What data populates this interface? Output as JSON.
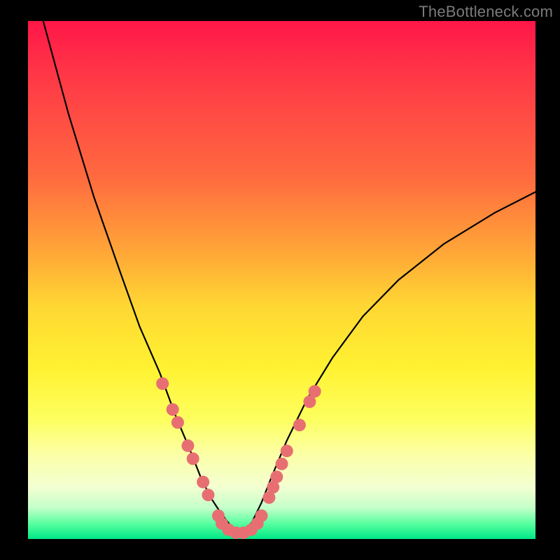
{
  "watermark": "TheBottleneck.com",
  "chart_data": {
    "type": "line",
    "title": "",
    "xlabel": "",
    "ylabel": "",
    "xlim": [
      0,
      100
    ],
    "ylim": [
      0,
      100
    ],
    "gradient_stops": [
      {
        "pct": 0,
        "color": "#ff1648"
      },
      {
        "pct": 10,
        "color": "#ff3647"
      },
      {
        "pct": 30,
        "color": "#ff6a3f"
      },
      {
        "pct": 45,
        "color": "#ffa837"
      },
      {
        "pct": 55,
        "color": "#ffd733"
      },
      {
        "pct": 67,
        "color": "#fff231"
      },
      {
        "pct": 77,
        "color": "#fdff60"
      },
      {
        "pct": 84,
        "color": "#fbffa9"
      },
      {
        "pct": 90,
        "color": "#f3ffd1"
      },
      {
        "pct": 94,
        "color": "#c4ffc9"
      },
      {
        "pct": 97,
        "color": "#59ff9f"
      },
      {
        "pct": 100,
        "color": "#00e887"
      }
    ],
    "series": [
      {
        "name": "left-branch",
        "x": [
          3,
          8,
          13,
          18,
          22,
          26,
          29,
          32,
          34,
          36,
          38,
          40,
          41.5
        ],
        "y": [
          100,
          82,
          66,
          52,
          41,
          32,
          24,
          17,
          12,
          8,
          5,
          2.5,
          1
        ]
      },
      {
        "name": "right-branch",
        "x": [
          41.5,
          44,
          46,
          48,
          51,
          55,
          60,
          66,
          73,
          82,
          92,
          100
        ],
        "y": [
          1,
          3,
          7,
          12,
          19,
          27,
          35,
          43,
          50,
          57,
          63,
          67
        ]
      }
    ],
    "markers": {
      "name": "highlight-dots",
      "color": "#e76f72",
      "radius_px": 9,
      "points": [
        {
          "x": 26.5,
          "y": 30
        },
        {
          "x": 28.5,
          "y": 25
        },
        {
          "x": 29.5,
          "y": 22.5
        },
        {
          "x": 31.5,
          "y": 18
        },
        {
          "x": 32.5,
          "y": 15.5
        },
        {
          "x": 34.5,
          "y": 11
        },
        {
          "x": 35.5,
          "y": 8.5
        },
        {
          "x": 37.5,
          "y": 4.5
        },
        {
          "x": 38.2,
          "y": 3
        },
        {
          "x": 39.5,
          "y": 1.8
        },
        {
          "x": 41,
          "y": 1.2
        },
        {
          "x": 42.5,
          "y": 1.2
        },
        {
          "x": 44,
          "y": 1.8
        },
        {
          "x": 45.2,
          "y": 3
        },
        {
          "x": 46,
          "y": 4.5
        },
        {
          "x": 47.5,
          "y": 8
        },
        {
          "x": 48.3,
          "y": 10
        },
        {
          "x": 49,
          "y": 12
        },
        {
          "x": 50,
          "y": 14.5
        },
        {
          "x": 51,
          "y": 17
        },
        {
          "x": 53.5,
          "y": 22
        },
        {
          "x": 55.5,
          "y": 26.5
        },
        {
          "x": 56.5,
          "y": 28.5
        }
      ]
    }
  }
}
